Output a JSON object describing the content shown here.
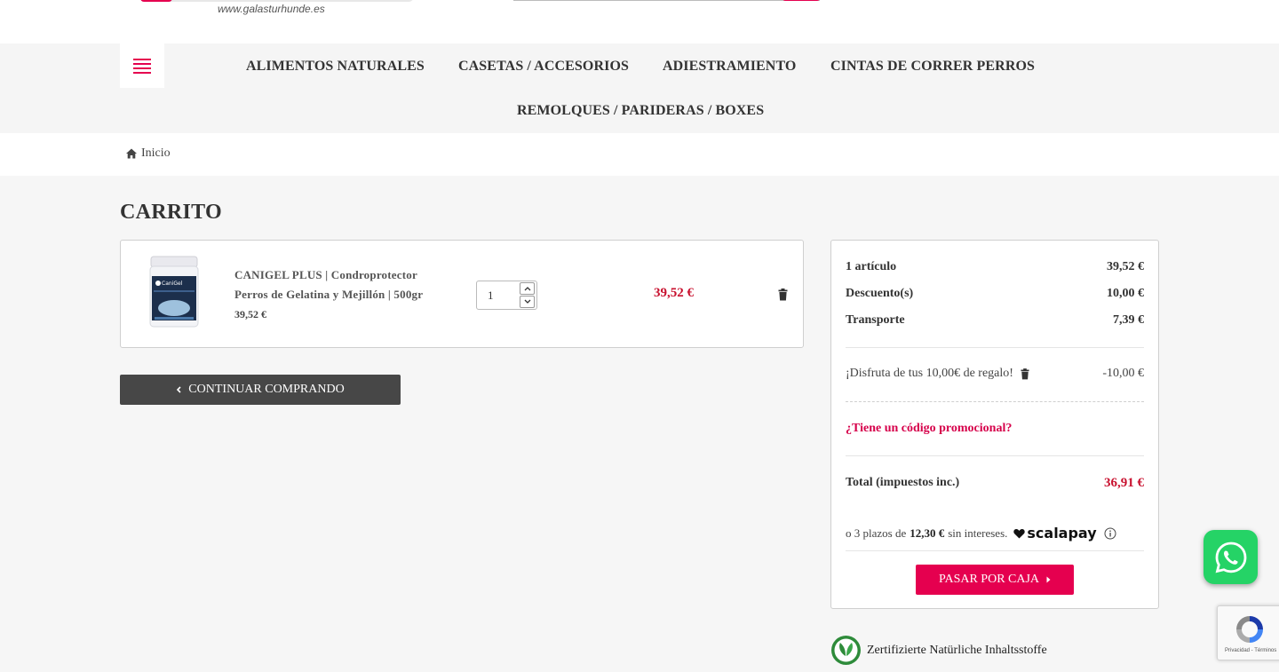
{
  "header": {
    "site_url": "www.galasturhunde.es"
  },
  "nav": {
    "items": [
      "ALIMENTOS NATURALES",
      "CASETAS / ACCESORIOS",
      "ADIESTRAMIENTO",
      "CINTAS DE CORRER PERROS",
      "REMOLQUES / PARIDERAS / BOXES"
    ]
  },
  "breadcrumb": {
    "home": "Inicio"
  },
  "page": {
    "title": "CARRITO"
  },
  "cart": {
    "item": {
      "name": "CANIGEL PLUS | Condroprotector Perros de Gelatina y Mejillón | 500gr",
      "unit_price": "39,52 €",
      "quantity": "1",
      "line_total": "39,52 €",
      "image_brand": "CaniGel"
    },
    "continue_label": "CONTINUAR COMPRANDO"
  },
  "summary": {
    "articles_label": "1 artículo",
    "articles_value": "39,52 €",
    "discount_label": "Descuento(s)",
    "discount_value": "10,00 €",
    "shipping_label": "Transporte",
    "shipping_value": "7,39 €",
    "voucher_label": "¡Disfruta de tus 10,00€ de regalo!",
    "voucher_value": "-10,00 €",
    "promo_link": "¿Tiene un código promocional?",
    "total_label": "Total (impuestos inc.)",
    "total_value": "36,91 €",
    "installments_prefix": "o 3 plazos de",
    "installments_amount": "12,30 €",
    "installments_suffix": "sin intereses.",
    "scalapay_brand": "scalapay",
    "checkout_label": "PASAR POR CAJA"
  },
  "badge": {
    "text": "Zertifizierte Natürliche Inhaltsstoffe"
  },
  "recaptcha": {
    "links": "Privacidad - Términos"
  },
  "colors": {
    "accent": "#e5004f",
    "price": "#c8102e",
    "dark_button": "#474747",
    "whatsapp": "#25d366"
  }
}
